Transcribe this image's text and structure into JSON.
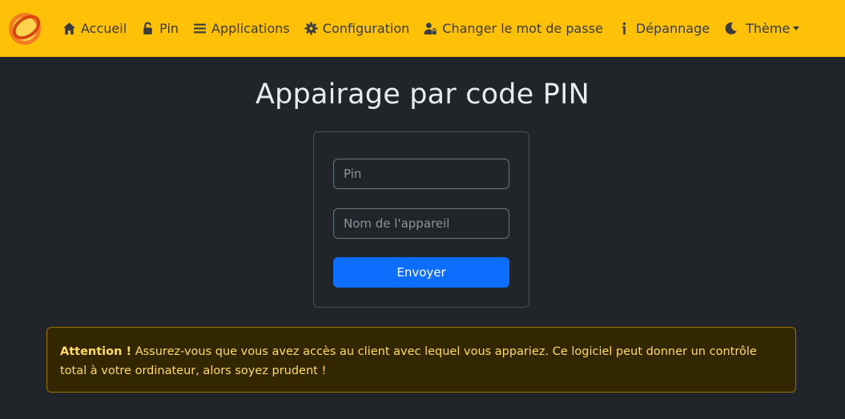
{
  "nav": {
    "logo_icon": "sunshine-logo-icon",
    "items": [
      {
        "label": "Accueil",
        "icon": "home-icon"
      },
      {
        "label": "Pin",
        "icon": "unlock-icon"
      },
      {
        "label": "Applications",
        "icon": "list-icon"
      },
      {
        "label": "Configuration",
        "icon": "gear-icon"
      },
      {
        "label": "Changer le mot de passe",
        "icon": "user-lock-icon"
      },
      {
        "label": "Dépannage",
        "icon": "info-icon"
      },
      {
        "label": "Thème",
        "icon": "moon-icon"
      }
    ]
  },
  "main": {
    "title": "Appairage par code PIN",
    "pin_placeholder": "Pin",
    "device_placeholder": "Nom de l'appareil",
    "submit_label": "Envoyer"
  },
  "alert": {
    "strong": "Attention !",
    "text": " Assurez-vous que vous avez accès au client avec lequel vous appariez. Ce logiciel peut donner un contrôle total à votre ordinateur, alors soyez prudent !"
  },
  "colors": {
    "navbar": "#ffc107",
    "background": "#212529",
    "primary": "#0d6efd",
    "alert_bg": "#332701",
    "alert_text": "#ffda6a"
  }
}
